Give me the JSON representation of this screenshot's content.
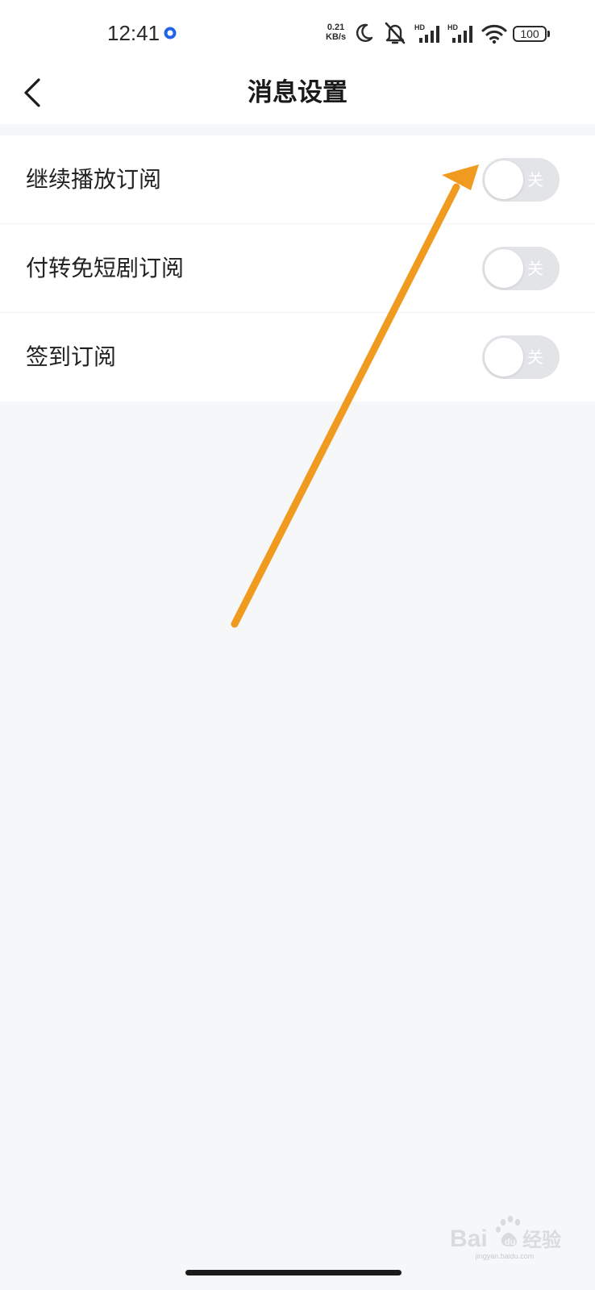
{
  "status_bar": {
    "time": "12:41",
    "net_speed_value": "0.21",
    "net_speed_unit": "KB/s",
    "hd_label_1": "HD",
    "hd_label_2": "HD",
    "battery": "100",
    "icons": [
      "location-dot-icon",
      "moon-icon",
      "mute-bell-icon",
      "signal-icon",
      "signal-icon",
      "wifi-icon",
      "battery-icon"
    ]
  },
  "header": {
    "title": "消息设置",
    "back_icon": "chevron-left-icon"
  },
  "settings": {
    "items": [
      {
        "label": "继续播放订阅",
        "toggle_text": "关",
        "enabled": false
      },
      {
        "label": "付转免短剧订阅",
        "toggle_text": "关",
        "enabled": false
      },
      {
        "label": "签到订阅",
        "toggle_text": "关",
        "enabled": false
      }
    ]
  },
  "annotation": {
    "color": "#f09a1f",
    "icon": "arrow-annotation"
  },
  "watermark": {
    "text": "jingyan.baidu.com"
  },
  "colors": {
    "toggle_off": "#e2e4e7",
    "background": "#f6f7f8",
    "accent_dot": "#2463e6"
  }
}
